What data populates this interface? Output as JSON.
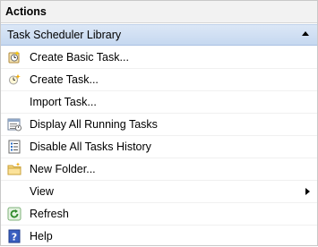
{
  "panel": {
    "title": "Actions"
  },
  "section": {
    "title": "Task Scheduler Library"
  },
  "items": [
    {
      "label": "Create Basic Task...",
      "icon": "basic-task-wizard-icon"
    },
    {
      "label": "Create Task...",
      "icon": "create-task-icon"
    },
    {
      "label": "Import Task...",
      "icon": ""
    },
    {
      "label": "Display All Running Tasks",
      "icon": "running-tasks-icon"
    },
    {
      "label": "Disable All Tasks History",
      "icon": "tasks-history-icon"
    },
    {
      "label": "New Folder...",
      "icon": "new-folder-icon"
    },
    {
      "label": "View",
      "icon": ""
    },
    {
      "label": "Refresh",
      "icon": "refresh-icon"
    },
    {
      "label": "Help",
      "icon": "help-icon"
    }
  ],
  "colors": {
    "section_header_bg": "#c6d8f0",
    "panel_header_bg": "#f2f2f2"
  }
}
